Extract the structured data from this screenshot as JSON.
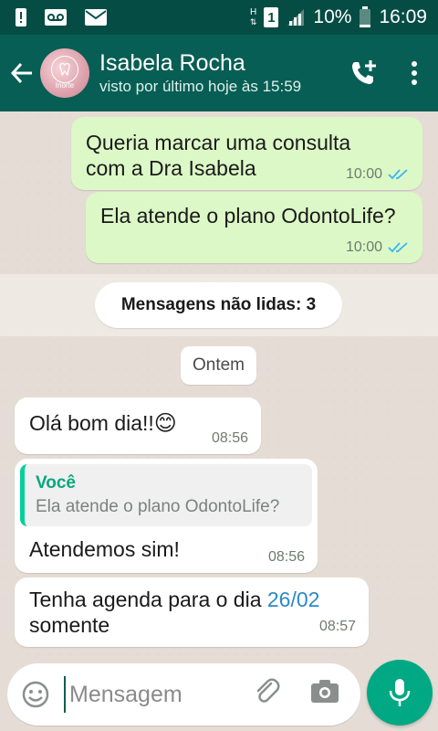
{
  "status_bar": {
    "battery_percent": "10%",
    "clock": "16:09",
    "sim_label": "1",
    "network_label": "H"
  },
  "header": {
    "contact_name": "Isabela Rocha",
    "last_seen": "visto por último hoje às 15:59",
    "avatar_text": "Inorte"
  },
  "messages": [
    {
      "direction": "outgoing",
      "text": "Queria marcar uma consulta com a Dra Isabela",
      "time": "10:00",
      "status": "read"
    },
    {
      "direction": "outgoing",
      "text": "Ela atende o plano OdontoLife?",
      "time": "10:00",
      "status": "read"
    },
    {
      "direction": "incoming",
      "text": "Olá bom dia!!",
      "emoji": "😊",
      "time": "08:56"
    },
    {
      "direction": "incoming",
      "reply_to": {
        "author": "Você",
        "text": "Ela atende o plano OdontoLife?"
      },
      "text": "Atendemos sim!",
      "time": "08:56"
    },
    {
      "direction": "incoming",
      "text_before": "Tenha agenda para o dia",
      "link": "26/02",
      "text_after": "somente",
      "time": "08:57"
    }
  ],
  "unread_label": "Mensagens não lidas: 3",
  "date_label": "Ontem",
  "composer": {
    "placeholder": "Mensagem"
  },
  "colors": {
    "header": "#075e54",
    "status_bar": "#054d44",
    "outgoing_bubble": "#dcf8c6",
    "incoming_bubble": "#ffffff",
    "mic_button": "#00a884",
    "read_ticks": "#34b7f1"
  }
}
